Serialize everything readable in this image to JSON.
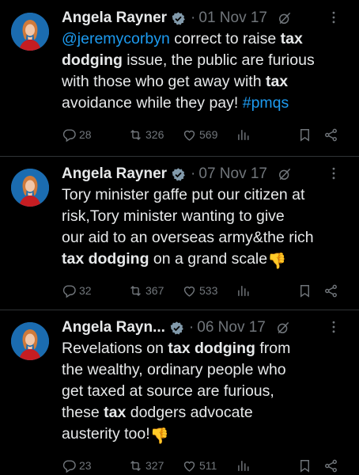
{
  "tweets": [
    {
      "author": "Angela Rayner",
      "date": "01 Nov 17",
      "lines": [
        [
          {
            "t": "@jeremycorbyn",
            "s": "link"
          },
          {
            "t": " correct to raise "
          },
          {
            "t": "tax",
            "s": "bold"
          }
        ],
        [
          {
            "t": "dodging",
            "s": "bold"
          },
          {
            "t": " issue, the public are furious"
          }
        ],
        [
          {
            "t": "with those who get away with "
          },
          {
            "t": "tax",
            "s": "bold"
          }
        ],
        [
          {
            "t": "avoidance while they pay! "
          },
          {
            "t": "#pmqs",
            "s": "link"
          }
        ]
      ],
      "replies": "28",
      "reposts": "326",
      "likes": "569"
    },
    {
      "author": "Angela Rayner",
      "date": "07 Nov 17",
      "lines": [
        [
          {
            "t": "Tory minister gaffe put our citizen at"
          }
        ],
        [
          {
            "t": "risk,Tory minister wanting to give"
          }
        ],
        [
          {
            "t": "our aid to an overseas army&the rich"
          }
        ],
        [
          {
            "t": "tax dodging",
            "s": "bold"
          },
          {
            "t": " on a grand scale"
          },
          {
            "t": "👎",
            "s": "emoji"
          }
        ]
      ],
      "replies": "32",
      "reposts": "367",
      "likes": "533"
    },
    {
      "author": "Angela Rayn...",
      "date": "06 Nov 17",
      "lines": [
        [
          {
            "t": "Revelations on "
          },
          {
            "t": "tax dodging",
            "s": "bold"
          },
          {
            "t": " from"
          }
        ],
        [
          {
            "t": "the wealthy, ordinary people who"
          }
        ],
        [
          {
            "t": "get taxed at source are furious,"
          }
        ],
        [
          {
            "t": "these "
          },
          {
            "t": "tax",
            "s": "bold"
          },
          {
            "t": " dodgers advocate"
          }
        ],
        [
          {
            "t": "austerity too!"
          },
          {
            "t": "👎",
            "s": "emoji"
          }
        ]
      ],
      "replies": "23",
      "reposts": "327",
      "likes": "511"
    }
  ],
  "icons": {
    "reply": "reply-icon",
    "repost": "repost-icon",
    "like": "like-icon",
    "views": "views-icon",
    "bookmark": "bookmark-icon",
    "share": "share-icon",
    "more": "more-icon",
    "verified": "verified-badge-icon",
    "grok": "grok-icon"
  },
  "colors": {
    "link": "#1d9bf0",
    "muted": "#71767b",
    "text": "#e7e9ea",
    "verified": "#829aab"
  }
}
